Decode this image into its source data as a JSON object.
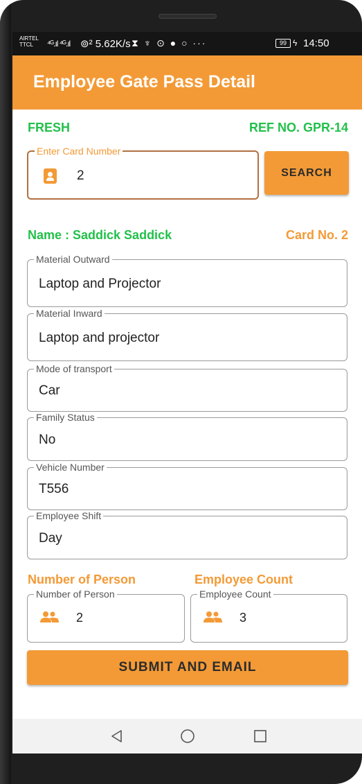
{
  "status_bar": {
    "carrier_line1": "AIRTEL",
    "carrier_line2": "TTCL",
    "signal": "⁴ᴳ.ıl ⁴ᴳ.ıl",
    "net_speed": "⊚² 5.62K/s",
    "icons": "⧗ ♆ ⊙ ● ○ ···",
    "battery": "99",
    "charging": "ϟ",
    "time": "14:50"
  },
  "app_bar": {
    "title": "Employee Gate Pass Detail"
  },
  "header_row": {
    "status": "FRESH",
    "ref_no": "REF NO. GPR-14"
  },
  "card_search": {
    "label": "Enter Card Number",
    "value": "2",
    "icon": "badge-icon",
    "button_label": "SEARCH"
  },
  "employee": {
    "name": "Name : Saddick Saddick",
    "card_no": "Card No. 2"
  },
  "fields": [
    {
      "label": "Material Outward",
      "value": "Laptop and Projector"
    },
    {
      "label": "Material Inward",
      "value": "Laptop and projector"
    },
    {
      "label": "Mode of transport",
      "value": "Car"
    },
    {
      "label": "Family Status",
      "value": "No"
    },
    {
      "label": "Vehicle Number",
      "value": "T556"
    },
    {
      "label": "Employee Shift",
      "value": "Day"
    }
  ],
  "counts": {
    "person_heading": "Number of Person",
    "person_label": "Number of Person",
    "person_value": "2",
    "employee_heading": "Employee Count",
    "employee_label": "Employee Count",
    "employee_value": "3",
    "icon": "people-icon"
  },
  "submit_label": "SUBMIT AND EMAIL",
  "nav": {
    "back": "back-icon",
    "home": "home-icon",
    "recents": "recents-icon"
  },
  "colors": {
    "accent": "#f39a36",
    "green": "#22c04a",
    "card_border": "#b07040"
  }
}
